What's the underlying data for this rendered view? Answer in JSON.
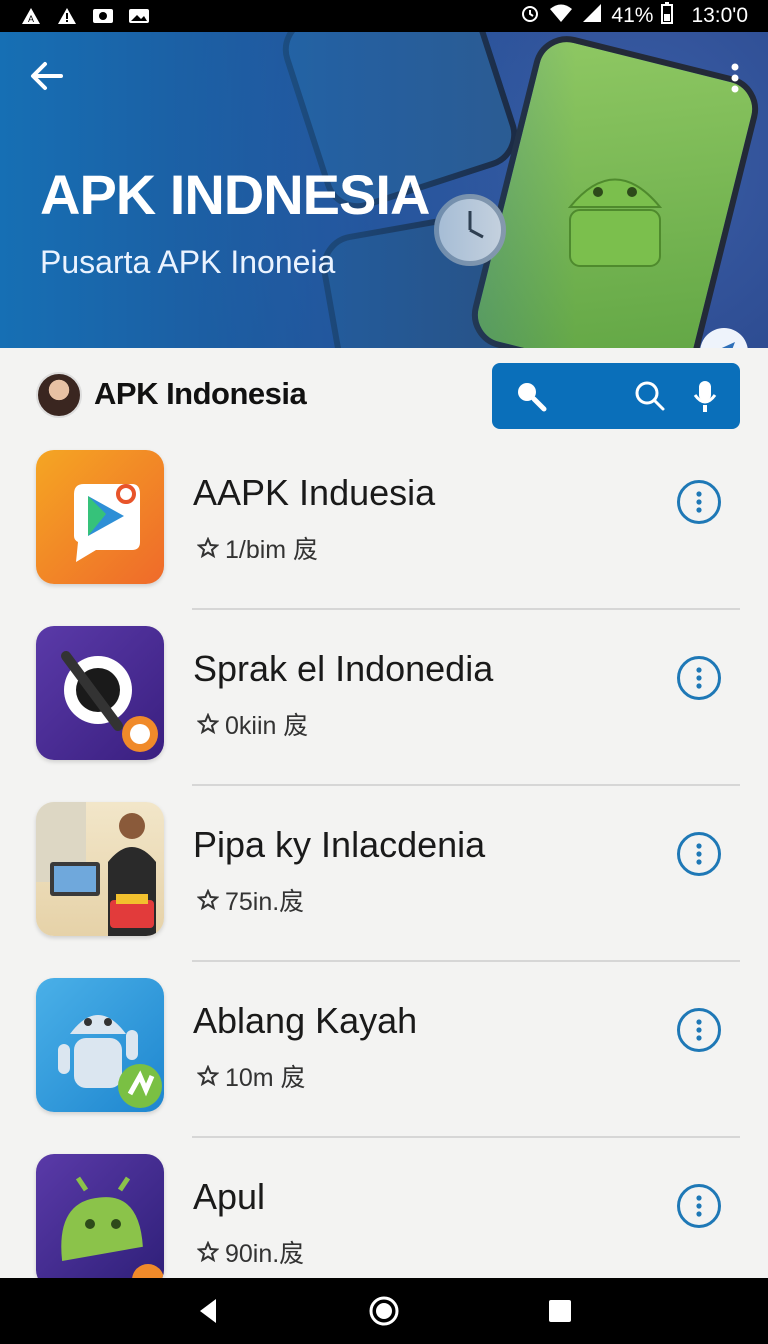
{
  "status": {
    "battery": "41%",
    "time": "13:0'0"
  },
  "hero": {
    "title": "APK INDNESIA",
    "subtitle": "Pusarta APK Inoneia"
  },
  "header": {
    "brand": "APK Indonesia"
  },
  "apps": [
    {
      "name": "AAPK Induesia",
      "meta": "1/bim 㧀"
    },
    {
      "name": "Sprak el Indonedia",
      "meta": "0kiin 㧀"
    },
    {
      "name": "Pipa ky Inlacdenia",
      "meta": "75in.㧀"
    },
    {
      "name": "Ablang Kayah",
      "meta": "10m 㧀"
    },
    {
      "name": "Apul",
      "meta": "90in.㧀"
    }
  ],
  "colors": {
    "accent": "#0a6fba",
    "background": "#f3f3f2"
  }
}
